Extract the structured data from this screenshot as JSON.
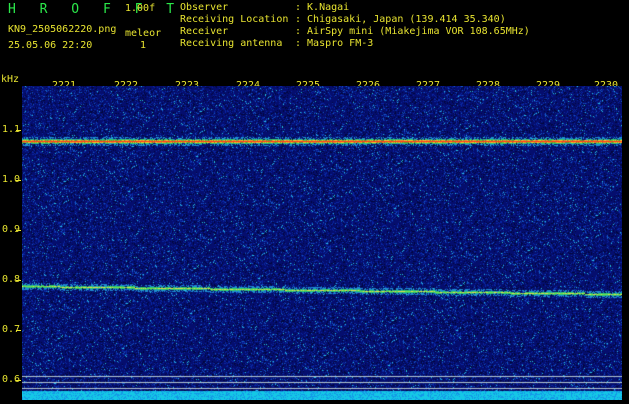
{
  "header": {
    "app_title": "H R O F F T",
    "version": "1.00f",
    "filename": "KN9_2505062220.png",
    "meleor_label": "meleor",
    "datetime": "25.05.06 22:20",
    "count": "1",
    "info": [
      {
        "key": "Observer",
        "value": ": K.Nagai"
      },
      {
        "key": "Receiving Location",
        "value": ": Chigasaki, Japan (139.414 35.340)"
      },
      {
        "key": "Receiver",
        "value": ": AirSpy mini (Miakejima VOR 108.65MHz)"
      },
      {
        "key": "Receiving antenna",
        "value": ": Maspro FM-3"
      }
    ]
  },
  "axis": {
    "y_unit": "kHz",
    "y_ticks": [
      "1.1",
      "1.0",
      "0.9",
      "0.8",
      "0.7",
      "0.6"
    ],
    "x_ticks": [
      "2221",
      "2222",
      "2223",
      "2224",
      "2225",
      "2226",
      "2227",
      "2228",
      "2229",
      "2230"
    ]
  },
  "colors": {
    "background": "#000000",
    "text": "#e8e430",
    "title": "#2be84a",
    "noise_base": "#06107a",
    "signal_strong": "#ff3a1c"
  }
}
